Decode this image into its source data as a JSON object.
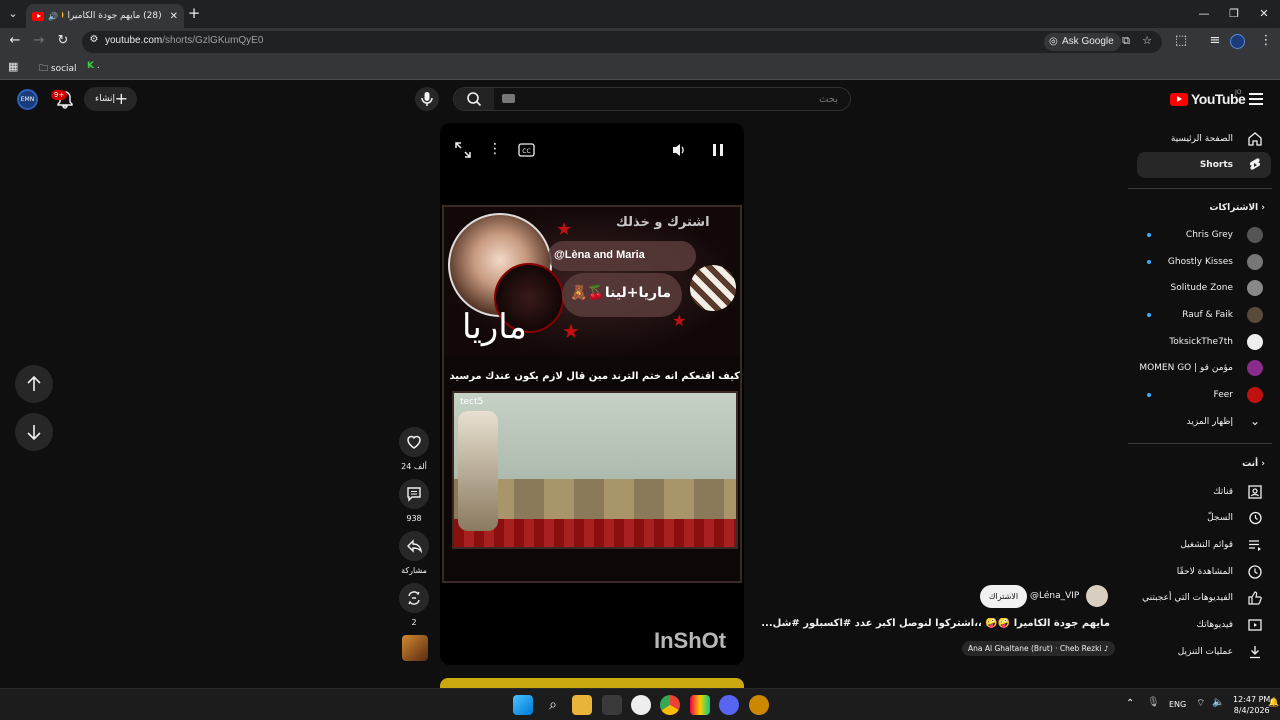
{
  "browser": {
    "tab_title": "(28) مايهم جودة الكاميرا 🤪🤪",
    "new_tab_icon": "plus-icon",
    "url_host": "youtube.com",
    "url_path": "/shorts/GzlGKumQyE0",
    "ask_google": "Ask Google",
    "bookmarks": [
      {
        "label": "social",
        "icon": "folder-icon"
      },
      {
        "label": ".",
        "icon": "k-icon"
      }
    ]
  },
  "youtube": {
    "logo_text": "YouTube",
    "logo_sup": "JO",
    "search_placeholder": "بحث",
    "create_label": "إنشاء",
    "notif_count": "9+",
    "avatar_text": "EMN",
    "sidebar": {
      "home": "الصفحة الرئيسية",
      "shorts": "Shorts",
      "subscriptions_heading": "الاشتراكات",
      "subscriptions": [
        {
          "name": "Chris Grey",
          "color": "#555555"
        },
        {
          "name": "Ghostly Kisses",
          "color": "#777777"
        },
        {
          "name": "Solitude Zone",
          "color": "#888888"
        },
        {
          "name": "Rauf & Faik",
          "color": "#5a4a3a"
        },
        {
          "name": "ToksickThe7th",
          "color": "#eeeeee"
        },
        {
          "name": "MOMEN GO | مؤمن قو",
          "color": "#8a2a8a"
        },
        {
          "name": "Feer",
          "color": "#c01010"
        }
      ],
      "show_more": "إظهار المزيد",
      "you_heading": "أنت",
      "you_items": [
        {
          "label": "قناتك",
          "icon": "channel-icon"
        },
        {
          "label": "السجلّ",
          "icon": "history-icon"
        },
        {
          "label": "قوائم التشغيل",
          "icon": "playlist-icon"
        },
        {
          "label": "المشاهدة لاحقًا",
          "icon": "clock-icon"
        },
        {
          "label": "الفيديوهات التي أعجبتني",
          "icon": "like-icon"
        },
        {
          "label": "فيديوهاتك",
          "icon": "video-icon"
        },
        {
          "label": "عمليات التنزيل",
          "icon": "download-icon"
        }
      ]
    },
    "short": {
      "overlay_top": "اشترك و خذلك",
      "handle": "@Lèna and Maria",
      "name_banner": "ماريا+لينا🍒🧸",
      "script_name": "ماريا",
      "caption": "كيف اقنعكم انه ختم الترند مين قال لازم يكون عندك مرسيدس، !!!",
      "tag": "tect5",
      "watermark": "InShOt",
      "likes": "24 ألف",
      "comments": "938",
      "share": "مشاركة",
      "remix": "2",
      "channel": "@Léna_VIP",
      "subscribe": "الاشتراك",
      "title": "مايهم جودة الكاميرا 🤪🤪 ،،اشتركوا لنوصل أكبر عدد #اكسبلور #شل...",
      "sound": "Ana Al Ghaltane (Brut) · Cheb Rezki"
    }
  },
  "taskbar": {
    "lang": "ENG",
    "time": "12:47 PM",
    "date": "8/4/2026"
  }
}
